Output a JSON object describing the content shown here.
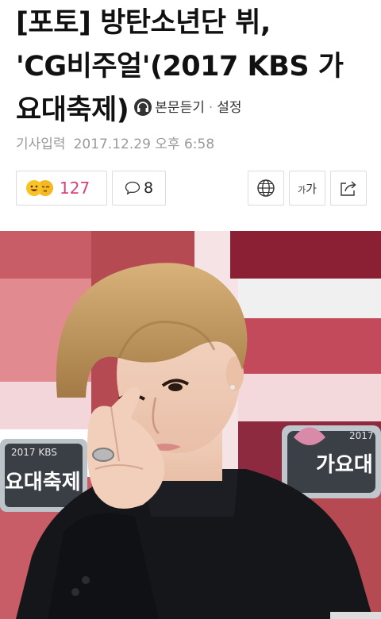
{
  "article": {
    "headline_lines": [
      "[포토] 방탄소년단 뷔,",
      "'CG비주얼'(2017 KBS 가",
      "요대축제)"
    ],
    "listen_label": "본문듣기",
    "settings_label": "설정",
    "date_label": "기사입력",
    "date_value": "2017.12.29 오후 6:58"
  },
  "toolbar": {
    "reaction_count": "127",
    "comment_count": "8",
    "font_label_small": "가",
    "font_label_large": "가"
  },
  "photo": {
    "backdrop_text_left": "요대축제",
    "backdrop_text_left_small": "2017 KBS",
    "backdrop_text_right": "가요대",
    "backdrop_text_right_small": "2017"
  },
  "colors": {
    "reaction_count": "#d8407a",
    "meta_text": "#9a9a9a",
    "button_border": "#dcdcdc"
  },
  "icons": [
    "headphone-icon",
    "smile-emoji-icon",
    "sleepy-emoji-icon",
    "speech-bubble-icon",
    "globe-icon",
    "font-size-icon",
    "share-icon"
  ]
}
